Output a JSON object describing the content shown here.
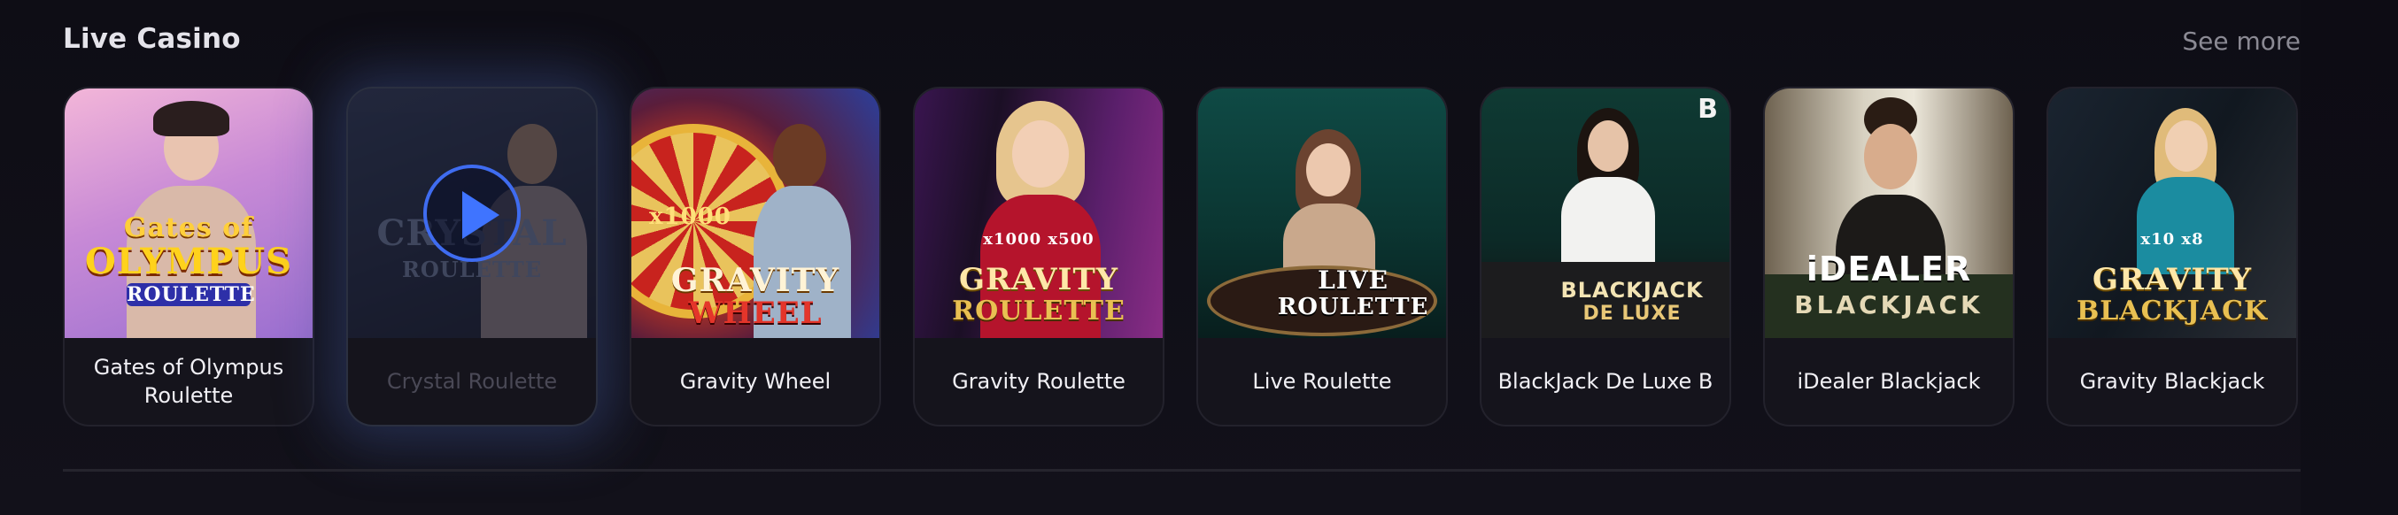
{
  "section": {
    "title": "Live Casino",
    "see_more": "See more"
  },
  "games": [
    {
      "name": "Gates of Olympus Roulette",
      "logo_top": "Gates of",
      "logo_main": "OLYMPUS",
      "logo_sub": "ROULETTE"
    },
    {
      "name": "Crystal Roulette",
      "logo_top": "",
      "logo_main": "CRYSTAL",
      "logo_sub": "ROULETTE"
    },
    {
      "name": "Gravity Wheel",
      "logo_top": "x1000",
      "logo_main": "GRAVITY",
      "logo_sub": "WHEEL"
    },
    {
      "name": "Gravity Roulette",
      "logo_top": "x1000  x500",
      "logo_main": "GRAVITY",
      "logo_sub": "ROULETTE"
    },
    {
      "name": "Live Roulette",
      "logo_top": "",
      "logo_main": "LIVE",
      "logo_sub": "ROULETTE"
    },
    {
      "name": "BlackJack De Luxe B",
      "logo_top": "B",
      "logo_main": "BLACKJACK",
      "logo_sub": "DE LUXE"
    },
    {
      "name": "iDealer Blackjack",
      "logo_top": "",
      "logo_main": "iDEALER",
      "logo_sub": "BLACKJACK"
    },
    {
      "name": "Gravity Blackjack",
      "logo_top": "x10  x8",
      "logo_main": "GRAVITY",
      "logo_sub": "BLACKJACK"
    }
  ],
  "icons": {
    "play": "play-icon"
  },
  "colors": {
    "background": "#0c0b12",
    "card": "#15141c",
    "accent_play": "#3f74ff",
    "muted_text": "#8b8a94"
  }
}
